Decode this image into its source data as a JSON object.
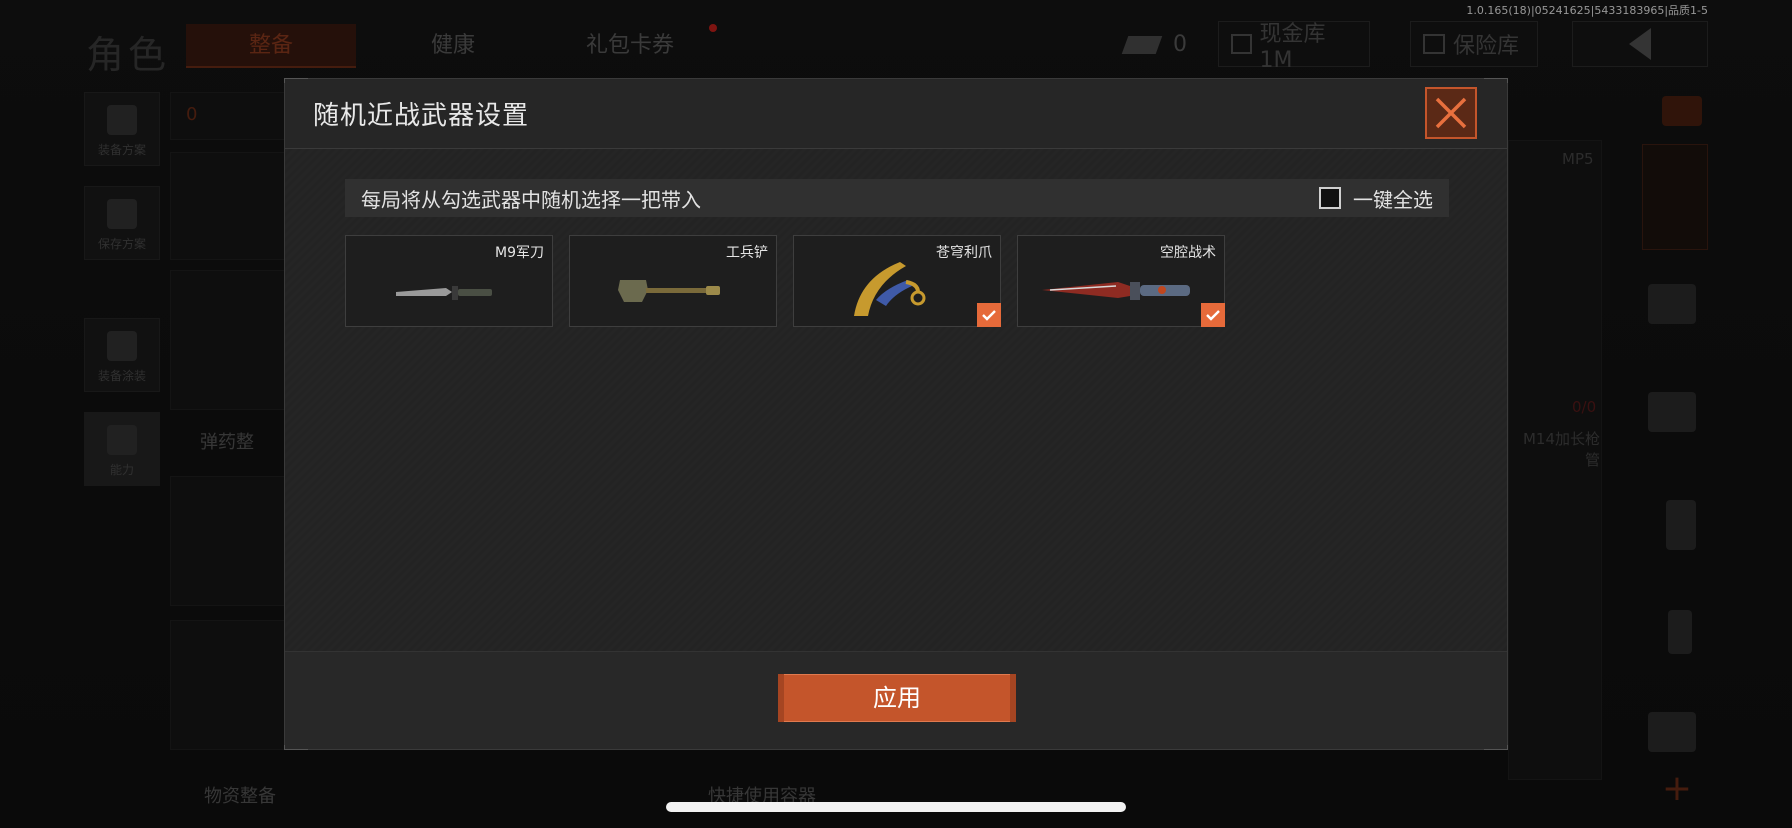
{
  "version_text": "1.0.165(18)|05241625|5433183965|品质1-5",
  "topbar": {
    "title": "角色",
    "tabs": [
      {
        "label": "整备",
        "active": true
      },
      {
        "label": "健康",
        "active": false
      },
      {
        "label": "礼包卡券",
        "active": false
      }
    ],
    "currency_value": "0",
    "cash_vault_label": "现金库 1M",
    "safe_label": "保险库"
  },
  "background": {
    "left_items": [
      "装备方案",
      "保存方案",
      "装备涂装",
      "能力"
    ],
    "armor_count": "0",
    "ammo_label": "弹药整",
    "supply_label": "物资整备",
    "quick_container_label": "快捷使用容器",
    "weapon_label": "MP5",
    "attachment_label": "M14加长枪管",
    "ammo_count": "0/0"
  },
  "dialog": {
    "title": "随机近战武器设置",
    "hint": "每局将从勾选武器中随机选择一把带入",
    "select_all_label": "一键全选",
    "select_all_checked": false,
    "weapons": [
      {
        "name": "M9军刀",
        "icon": "bayonet-knife-icon",
        "checked": false
      },
      {
        "name": "工兵铲",
        "icon": "shovel-icon",
        "checked": false
      },
      {
        "name": "苍穹利爪",
        "icon": "karambit-icon",
        "checked": true
      },
      {
        "name": "空腔战术",
        "icon": "tactical-knife-icon",
        "checked": true
      }
    ],
    "apply_label": "应用"
  },
  "colors": {
    "accent": "#c4552b",
    "check": "#e66a3a",
    "dialog_bg": "#222222"
  }
}
